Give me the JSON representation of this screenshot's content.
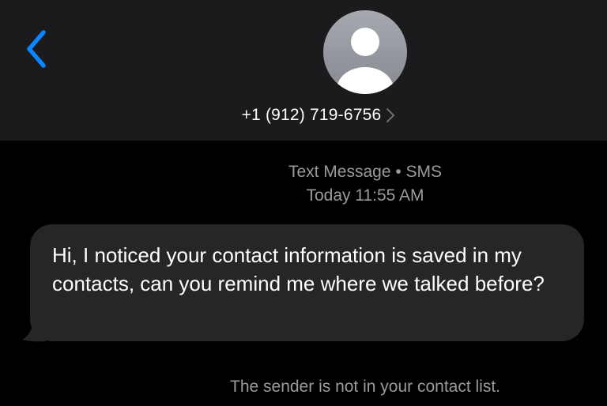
{
  "header": {
    "back_icon": "chevron-left-icon",
    "avatar_icon": "person-silhouette-icon",
    "contact_name": "+1 (912) 719-6756",
    "contact_chevron_icon": "chevron-right-icon"
  },
  "thread": {
    "service_label": "Text Message • SMS",
    "timestamp": "Today 11:55 AM",
    "messages": [
      {
        "direction": "incoming",
        "text": "Hi, I noticed your contact information is saved in my contacts, can you remind me where we talked before?"
      }
    ],
    "footer_notice": "The sender is not in your contact list."
  },
  "colors": {
    "accent": "#0a84ff",
    "header_bg": "#1b1b1d",
    "background": "#000000",
    "bubble_incoming": "#262628",
    "secondary_text": "#9a9a9f"
  }
}
